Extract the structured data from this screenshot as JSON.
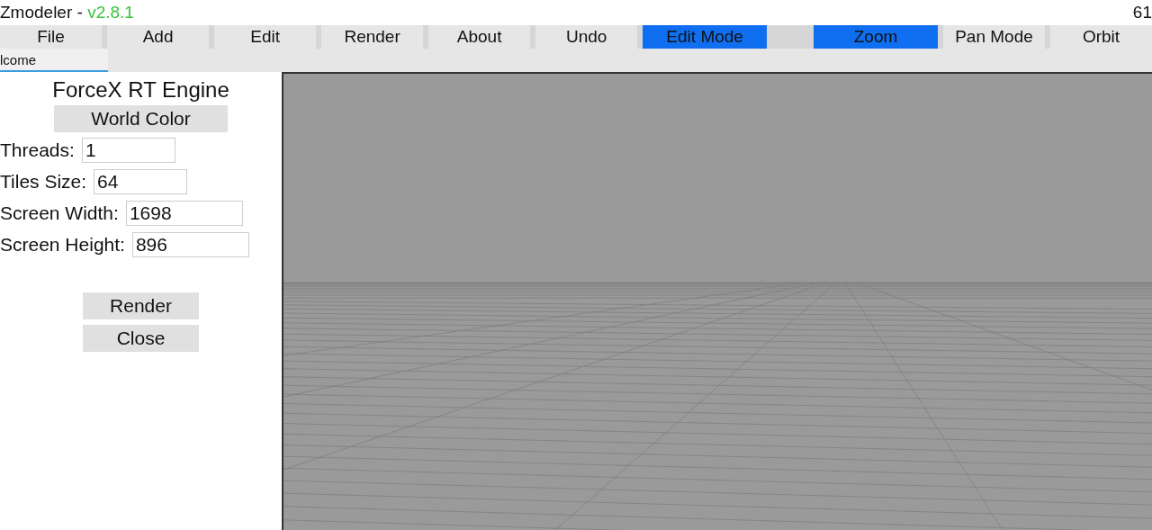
{
  "window": {
    "title": "Zmodeler - ",
    "version": "v2.8.1",
    "fps": "61"
  },
  "menu": [
    {
      "label": "File",
      "selected": false
    },
    {
      "label": "Add",
      "selected": false
    },
    {
      "label": "Edit",
      "selected": false
    },
    {
      "label": "Render",
      "selected": false
    },
    {
      "label": "About",
      "selected": false
    },
    {
      "label": "Undo",
      "selected": false
    },
    {
      "label": "Edit Mode",
      "selected": true
    },
    {
      "label": "Zoom",
      "selected": true
    },
    {
      "label": "Pan Mode",
      "selected": false
    },
    {
      "label": "Orbit",
      "selected": false
    }
  ],
  "tabs": [
    {
      "label": "lcome",
      "selected": true
    }
  ],
  "panel": {
    "title": "ForceX RT Engine",
    "color_button": "World Color",
    "fields": [
      {
        "label": "Threads:",
        "value": "1"
      },
      {
        "label": "Tiles Size:",
        "value": "64"
      },
      {
        "label": "Screen Width:",
        "value": "1698"
      },
      {
        "label": "Screen Height:",
        "value": "896"
      }
    ],
    "buttons": [
      "Render",
      "Close"
    ]
  }
}
